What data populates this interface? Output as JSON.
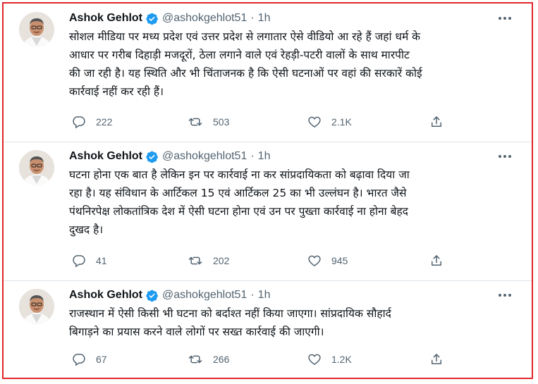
{
  "tweets": [
    {
      "name": "Ashok Gehlot",
      "handle": "@ashokgehlot51",
      "dot": "·",
      "time": "1h",
      "text": "सोशल मीडिया पर मध्य प्रदेश एवं उत्तर प्रदेश से लगातार ऐसे वीडियो आ रहे हैं जहां धर्म के\nआधार पर गरीब दिहाड़ी मजदूरों, ठेला लगाने वाले एवं रेहड़ी-पटरी वालों के साथ मारपीट\nकी जा रही है। यह स्थिति और भी चिंताजनक है कि ऐसी घटनाओं पर वहां की सरकारें कोई\nकार्रवाई नहीं कर रही हैं।",
      "replies": "222",
      "retweets": "503",
      "likes": "2.1K"
    },
    {
      "name": "Ashok Gehlot",
      "handle": "@ashokgehlot51",
      "dot": "·",
      "time": "1h",
      "text": "घटना होना एक बात है लेकिन इन पर कार्रवाई ना कर सांप्रदायिकता को बढ़ावा दिया जा\nरहा है।  यह संविधान के आर्टिकल 15 एवं आर्टिकल 25 का भी उल्लंघन है। भारत जैसे\nपंथनिरपेक्ष लोकतांत्रिक देश में ऐसी घटना होना एवं उन पर पुख्ता कार्रवाई ना होना बेहद\nदुखद है।",
      "replies": "41",
      "retweets": "202",
      "likes": "945"
    },
    {
      "name": "Ashok Gehlot",
      "handle": "@ashokgehlot51",
      "dot": "·",
      "time": "1h",
      "text": "राजस्थान में ऐसी किसी भी घटना को बर्दाश्त नहीं किया जाएगा। सांप्रदायिक सौहार्द\nबिगाड़ने का प्रयास करने वाले लोगों पर सख्त कार्रवाई की जाएगी।",
      "replies": "67",
      "retweets": "266",
      "likes": "1.2K"
    }
  ],
  "icons": {
    "reply": "reply-icon",
    "retweet": "retweet-icon",
    "like": "like-icon",
    "share": "share-icon",
    "verified": "verified-badge-icon",
    "more": "more-icon"
  },
  "colors": {
    "frame_border": "#e0262b",
    "verified": "#1d9bf0",
    "secondary_text": "#536471",
    "primary_text": "#0f1419"
  }
}
